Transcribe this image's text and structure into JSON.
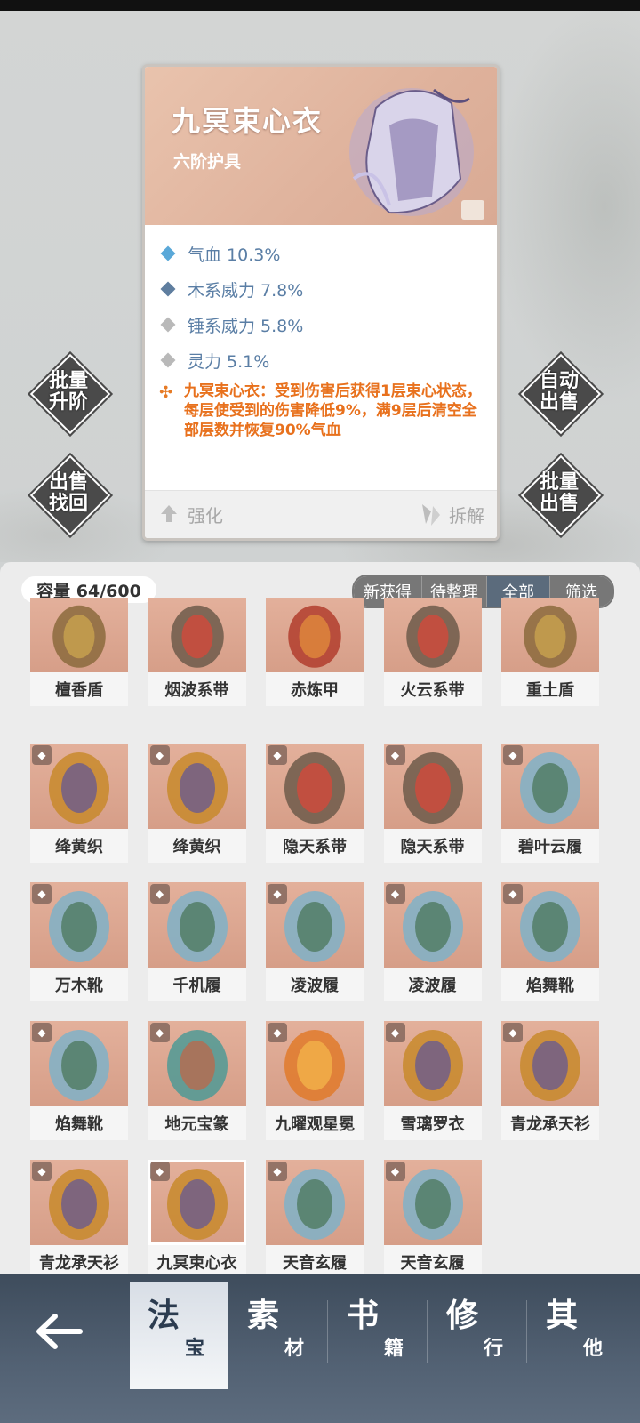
{
  "item_detail": {
    "name": "九冥束心衣",
    "grade": "六阶护具",
    "stats": [
      {
        "text": "气血 10.3%",
        "color": "#5aa8d8"
      },
      {
        "text": "木系威力 7.8%",
        "color": "#5f7e9f"
      },
      {
        "text": "锤系威力 5.8%",
        "color": "#b9b9b9"
      },
      {
        "text": "灵力 5.1%",
        "color": "#b9b9b9"
      }
    ],
    "effect": "九冥束心衣：受到伤害后获得1层束心状态，每层使受到的伤害降低9%，满9层后清空全部层数并恢复90%气血",
    "strengthen_label": "强化",
    "disassemble_label": "拆解"
  },
  "side_buttons": {
    "batch_upgrade": [
      "批量",
      "升阶"
    ],
    "sell_retrieve": [
      "出售",
      "找回"
    ],
    "auto_sell": [
      "自动",
      "出售"
    ],
    "batch_sell": [
      "批量",
      "出售"
    ]
  },
  "inventory": {
    "capacity": "容量 64/600",
    "filters": [
      "新获得",
      "待整理",
      "全部",
      "筛选"
    ],
    "active_filter": "全部",
    "items": [
      {
        "name": "檀香盾",
        "icon": "shield-icon"
      },
      {
        "name": "烟波系带",
        "icon": "sash-icon"
      },
      {
        "name": "赤炼甲",
        "icon": "armor-icon"
      },
      {
        "name": "火云系带",
        "icon": "sash-icon"
      },
      {
        "name": "重土盾",
        "icon": "shield-icon"
      },
      {
        "name": "绛黄织",
        "icon": "robe-icon"
      },
      {
        "name": "绛黄织",
        "icon": "robe-icon"
      },
      {
        "name": "隐天系带",
        "icon": "sash-icon"
      },
      {
        "name": "隐天系带",
        "icon": "sash-icon"
      },
      {
        "name": "碧叶云履",
        "icon": "boots-icon"
      },
      {
        "name": "万木靴",
        "icon": "boots-icon"
      },
      {
        "name": "千机履",
        "icon": "boots-icon"
      },
      {
        "name": "凌波履",
        "icon": "boots-icon"
      },
      {
        "name": "凌波履",
        "icon": "boots-icon"
      },
      {
        "name": "焰舞靴",
        "icon": "boots-icon"
      },
      {
        "name": "焰舞靴",
        "icon": "boots-icon"
      },
      {
        "name": "地元宝篆",
        "icon": "seal-icon"
      },
      {
        "name": "九曜观星冕",
        "icon": "crown-icon"
      },
      {
        "name": "雪璃罗衣",
        "icon": "robe-icon"
      },
      {
        "name": "青龙承天衫",
        "icon": "robe-icon"
      },
      {
        "name": "青龙承天衫",
        "icon": "robe-icon"
      },
      {
        "name": "九冥束心衣",
        "icon": "robe-icon",
        "selected": true
      },
      {
        "name": "天音玄履",
        "icon": "boots-icon"
      },
      {
        "name": "天音玄履",
        "icon": "boots-icon"
      }
    ]
  },
  "bottom_nav": {
    "tabs": [
      {
        "big": "法",
        "small": "宝",
        "active": true
      },
      {
        "big": "素",
        "small": "材"
      },
      {
        "big": "书",
        "small": "籍"
      },
      {
        "big": "修",
        "small": "行"
      },
      {
        "big": "其",
        "small": "他"
      }
    ]
  }
}
